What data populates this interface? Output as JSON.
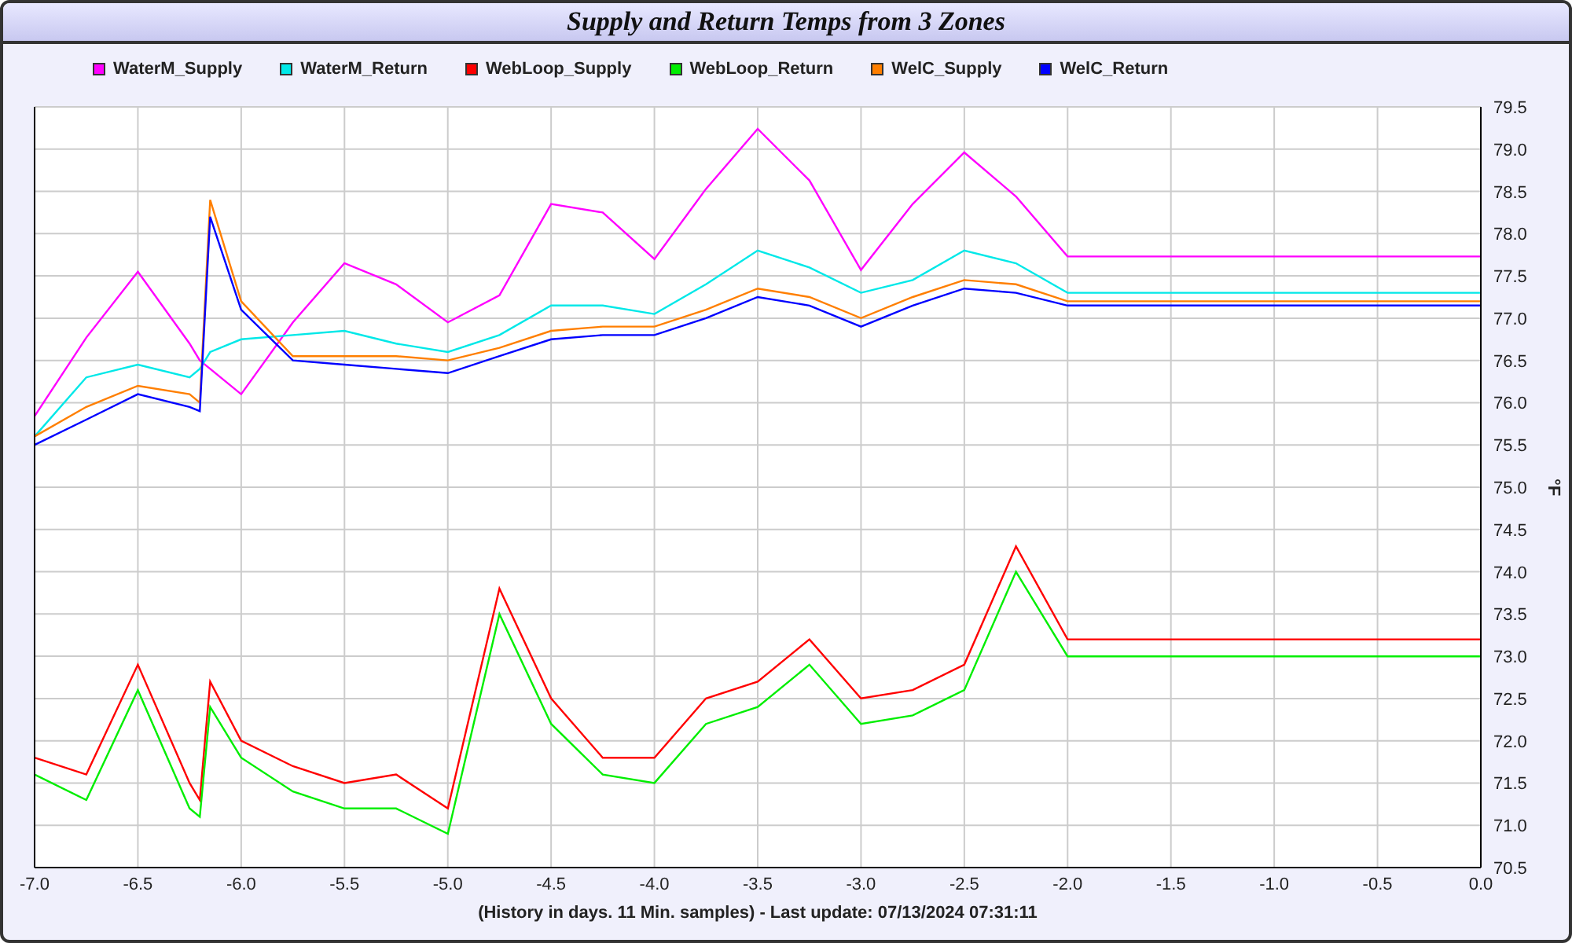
{
  "chart_data": {
    "type": "line",
    "grid": true,
    "title": "Supply and Return Temps from 3 Zones",
    "xlabel": "(History in days. 11 Min. samples) - Last update: 07/13/2024 07:31:11",
    "ylabel": "°F",
    "x": [
      -7,
      -6.75,
      -6.5,
      -6.25,
      -6.2,
      -6.15,
      -6,
      -5.75,
      -5.5,
      -5.25,
      -5,
      -4.75,
      -4.5,
      -4.25,
      -4,
      -3.75,
      -3.5,
      -3.25,
      -3,
      -2.75,
      -2.5,
      -2.25,
      -2,
      0
    ],
    "series": [
      {
        "name": "WaterM_Supply",
        "color": "#ff00ff",
        "values": [
          75.84,
          76.77,
          77.55,
          76.7,
          76.5,
          76.4,
          76.1,
          76.95,
          77.65,
          77.4,
          76.95,
          77.27,
          78.35,
          78.25,
          77.7,
          78.53,
          79.24,
          78.63,
          77.57,
          78.35,
          78.96,
          78.44,
          77.73,
          77.73
        ]
      },
      {
        "name": "WaterM_Return",
        "color": "#00e8e8",
        "values": [
          75.6,
          76.3,
          76.45,
          76.3,
          76.4,
          76.6,
          76.75,
          76.8,
          76.85,
          76.7,
          76.6,
          76.8,
          77.15,
          77.15,
          77.05,
          77.4,
          77.8,
          77.6,
          77.3,
          77.45,
          77.8,
          77.65,
          77.3,
          77.3
        ]
      },
      {
        "name": "WebLoop_Supply",
        "color": "#ff0000",
        "values": [
          71.8,
          71.6,
          72.9,
          71.5,
          71.3,
          72.7,
          72.0,
          71.7,
          71.5,
          71.6,
          71.2,
          73.8,
          72.5,
          71.8,
          71.8,
          72.5,
          72.7,
          73.2,
          72.5,
          72.6,
          72.9,
          74.3,
          73.2,
          73.2
        ]
      },
      {
        "name": "WebLoop_Return",
        "color": "#00ee00",
        "values": [
          71.6,
          71.3,
          72.6,
          71.2,
          71.1,
          72.4,
          71.8,
          71.4,
          71.2,
          71.2,
          70.9,
          73.5,
          72.2,
          71.6,
          71.5,
          72.2,
          72.4,
          72.9,
          72.2,
          72.3,
          72.6,
          74.0,
          73.0,
          73.0
        ]
      },
      {
        "name": "WelC_Supply",
        "color": "#ff7f00",
        "values": [
          75.6,
          75.95,
          76.2,
          76.1,
          76.0,
          78.4,
          77.2,
          76.55,
          76.55,
          76.55,
          76.5,
          76.65,
          76.85,
          76.9,
          76.9,
          77.1,
          77.35,
          77.25,
          77.0,
          77.25,
          77.45,
          77.4,
          77.2,
          77.2
        ]
      },
      {
        "name": "WelC_Return",
        "color": "#0000ff",
        "values": [
          75.5,
          75.8,
          76.1,
          75.95,
          75.9,
          78.2,
          77.1,
          76.5,
          76.45,
          76.4,
          76.35,
          76.55,
          76.75,
          76.8,
          76.8,
          77.0,
          77.25,
          77.15,
          76.9,
          77.15,
          77.35,
          77.3,
          77.15,
          77.15
        ]
      }
    ],
    "xlim": [
      -7,
      0
    ],
    "ylim": [
      70.5,
      79.5
    ],
    "xticks": [
      {
        "value": -7,
        "label": "-7.0"
      },
      {
        "value": -6.5,
        "label": "-6.5"
      },
      {
        "value": -6,
        "label": "-6.0"
      },
      {
        "value": -5.5,
        "label": "-5.5"
      },
      {
        "value": -5,
        "label": "-5.0"
      },
      {
        "value": -4.5,
        "label": "-4.5"
      },
      {
        "value": -4,
        "label": "-4.0"
      },
      {
        "value": -3.5,
        "label": "-3.5"
      },
      {
        "value": -3,
        "label": "-3.0"
      },
      {
        "value": -2.5,
        "label": "-2.5"
      },
      {
        "value": -2,
        "label": "-2.0"
      },
      {
        "value": -1.5,
        "label": "-1.5"
      },
      {
        "value": -1,
        "label": "-1.0"
      },
      {
        "value": -0.5,
        "label": "-0.5"
      },
      {
        "value": 0,
        "label": "0.0"
      }
    ],
    "yticks": [
      {
        "value": 70.5,
        "label": "70.5"
      },
      {
        "value": 71,
        "label": "71.0"
      },
      {
        "value": 71.5,
        "label": "71.5"
      },
      {
        "value": 72,
        "label": "72.0"
      },
      {
        "value": 72.5,
        "label": "72.5"
      },
      {
        "value": 73,
        "label": "73.0"
      },
      {
        "value": 73.5,
        "label": "73.5"
      },
      {
        "value": 74,
        "label": "74.0"
      },
      {
        "value": 74.5,
        "label": "74.5"
      },
      {
        "value": 75,
        "label": "75.0"
      },
      {
        "value": 75.5,
        "label": "75.5"
      },
      {
        "value": 76,
        "label": "76.0"
      },
      {
        "value": 76.5,
        "label": "76.5"
      },
      {
        "value": 77,
        "label": "77.0"
      },
      {
        "value": 77.5,
        "label": "77.5"
      },
      {
        "value": 78,
        "label": "78.0"
      },
      {
        "value": 78.5,
        "label": "78.5"
      },
      {
        "value": 79,
        "label": "79.0"
      },
      {
        "value": 79.5,
        "label": "79.5"
      }
    ]
  }
}
